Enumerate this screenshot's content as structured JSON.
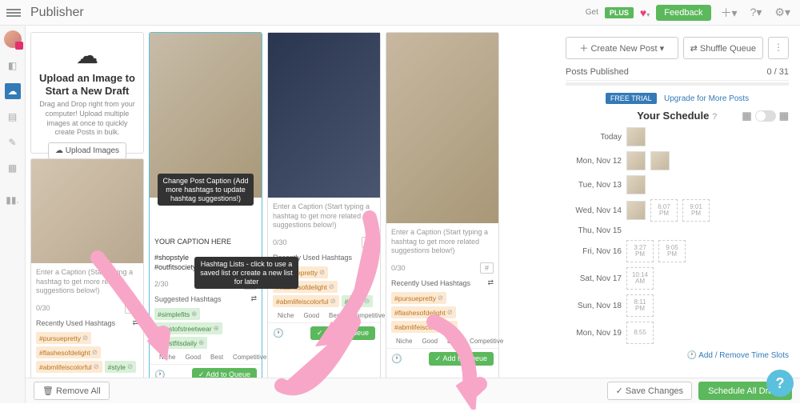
{
  "header": {
    "title": "Publisher",
    "get_label": "Get",
    "plus": "PLUS",
    "feedback": "Feedback"
  },
  "upload": {
    "title": "Upload an Image to Start a New Draft",
    "desc": "Drag and Drop right from your computer! Upload multiple images at once to quickly create Posts in bulk.",
    "button": "Upload Images"
  },
  "drafts": [
    {
      "placeholder": "Enter a Caption (Start typing a hashtag to get more related suggestions below!)",
      "counter": "0/30",
      "recent_label": "Recently Used Hashtags",
      "tags": [
        "#pursuepretty",
        "#flashesofdelight",
        "#abmlifeiscolorful",
        "#style"
      ]
    },
    {
      "caption_value": "YOUR CAPTION HERE",
      "existing": "#shopstyle\n#outfitsociety",
      "counter": "2/30",
      "suggested_label": "Suggested Hashtags",
      "tags": [
        "#simplefits",
        "#bestofstreetwear",
        "#bestfitsdaily"
      ],
      "tooltip_caption": "Change Post Caption\n(Add more hashtags to update hashtag suggestions!)",
      "tooltip_lists": "Hashtag Lists - click to use a saved list or create a new list for later",
      "add_to_queue": "Add to Queue"
    },
    {
      "placeholder": "Enter a Caption (Start typing a hashtag to get more related suggestions below!)",
      "counter": "0/30",
      "recent_label": "Recently Used Hashtags",
      "tags": [
        "#pursuepretty",
        "#flashesofdelight",
        "#abmlifeiscolorful",
        "#style"
      ],
      "add_to_queue": "Add to Queue"
    },
    {
      "placeholder": "Enter a Caption (Start typing a hashtag to get more related suggestions below!)",
      "counter": "0/30",
      "recent_label": "Recently Used Hashtags",
      "tags": [
        "#pursuepretty",
        "#flashesofdelight",
        "#abmlifeiscolorful"
      ],
      "add_to_queue": "Add to Queue"
    }
  ],
  "legend": {
    "niche": "Niche",
    "good": "Good",
    "best": "Best",
    "comp": "Competitive"
  },
  "right": {
    "create": "Create New Post",
    "shuffle": "Shuffle Queue",
    "posts_published": "Posts Published",
    "posts_count": "0 / 31",
    "trial": "FREE TRIAL",
    "upgrade": "Upgrade for More Posts",
    "schedule_title": "Your Schedule",
    "days": [
      {
        "label": "Today",
        "thumbs": 1
      },
      {
        "label": "Mon, Nov 12",
        "thumbs": 2
      },
      {
        "label": "Tue, Nov 13",
        "thumbs": 1
      },
      {
        "label": "Wed, Nov 14",
        "thumbs": 1,
        "slots": [
          "6:07 PM",
          "9:01 PM"
        ]
      },
      {
        "label": "Thu, Nov 15"
      },
      {
        "label": "Fri, Nov 16",
        "slots": [
          "3:27 PM",
          "9:05 PM"
        ]
      },
      {
        "label": "Sat, Nov 17",
        "slots": [
          "10:14 AM"
        ]
      },
      {
        "label": "Sun, Nov 18",
        "slots": [
          "8:11 PM"
        ]
      },
      {
        "label": "Mon, Nov 19",
        "slots": [
          "8:55"
        ]
      }
    ],
    "add_remove": "Add / Remove Time Slots"
  },
  "bottom": {
    "remove_all": "Remove All",
    "save": "Save Changes",
    "schedule_all": "Schedule All Drafts"
  }
}
